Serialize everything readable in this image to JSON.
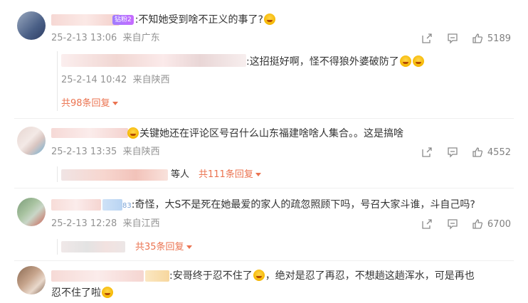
{
  "comments": [
    {
      "badge": "钻粉2",
      "text": ":不知她受到啥不正义的事了?",
      "time": "25-2-13 13:06",
      "location": "来自广东",
      "likes": "5189",
      "reply": {
        "text": ":这招挺好啊，怪不得狼外婆破防了",
        "time": "25-2-14 10:42",
        "location": "来自陕西"
      },
      "more_replies": "共98条回复"
    },
    {
      "text": "关键她还在评论区号召什么山东福建啥啥人集合。。这是搞啥",
      "time": "25-2-13 13:35",
      "location": "来自陕西",
      "likes": "4552",
      "reply_prefix": "等人",
      "more_replies": "共111条回复"
    },
    {
      "badge_num": "83",
      "text": ":奇怪，大S不是死在她最爱的家人的疏忽照顾下吗，号召大家斗谁，斗自己吗?",
      "time": "25-2-13 12:28",
      "location": "来自江西",
      "likes": "6700",
      "more_replies": "共35条回复"
    },
    {
      "text_line1": ":安哥终于忍不住了",
      "text_line1b": "，绝对是忍了再忍，不想趟这趟浑水，可是再也",
      "text_line2": "忍不住了啦"
    }
  ],
  "icons": {
    "share": "share-icon",
    "comment": "comment-icon",
    "like": "thumbs-up-icon"
  }
}
